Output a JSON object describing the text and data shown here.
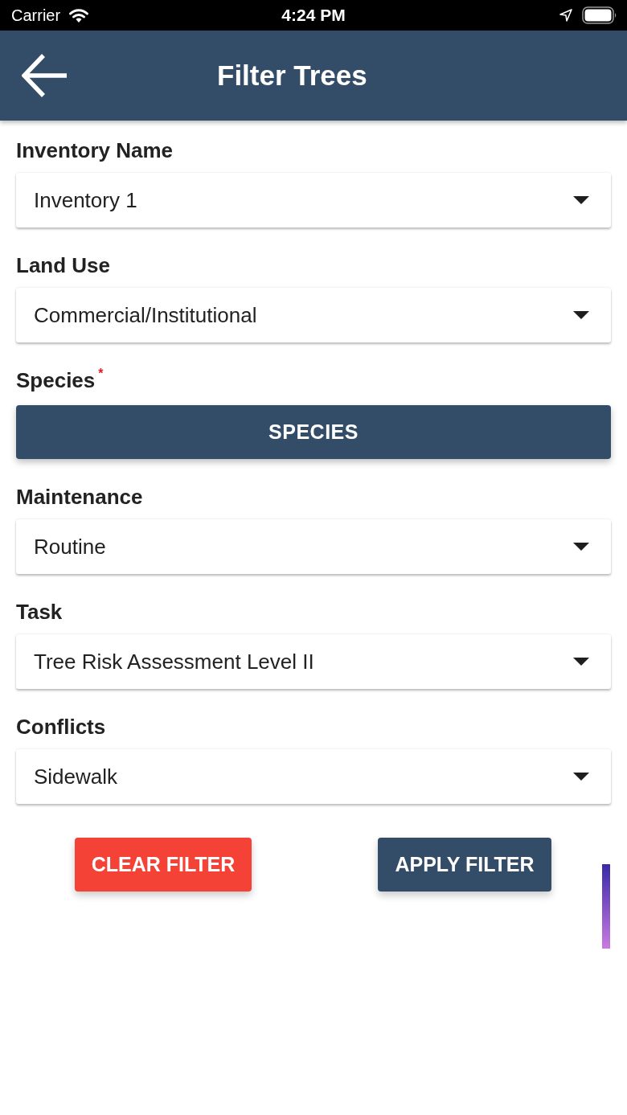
{
  "status_bar": {
    "carrier": "Carrier",
    "time": "4:24 PM"
  },
  "header": {
    "title": "Filter Trees"
  },
  "fields": [
    {
      "kind": "dropdown",
      "label": "Inventory Name",
      "value": "Inventory 1"
    },
    {
      "kind": "dropdown",
      "label": "Land Use",
      "value": "Commercial/Institutional"
    },
    {
      "kind": "button",
      "label": "Species$^{*}$",
      "button": "SPECIES"
    },
    {
      "kind": "dropdown",
      "label": "Maintenance",
      "value": "Routine"
    },
    {
      "kind": "dropdown",
      "label": "Task",
      "value": "Tree Risk Assessment Level II"
    },
    {
      "kind": "dropdown",
      "label": "Conflicts",
      "value": "Sidewalk"
    }
  ],
  "actions": [
    {
      "kind": "clear",
      "label": "CLEAR FILTER"
    },
    {
      "kind": "apply",
      "label": "APPLY FILTER"
    }
  ]
}
